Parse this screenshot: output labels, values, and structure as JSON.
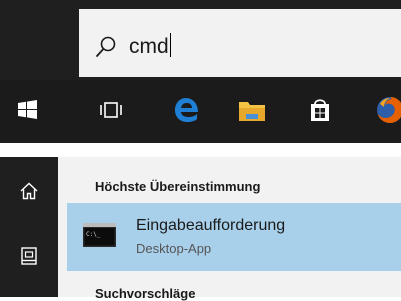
{
  "search": {
    "query": "cmd",
    "icon": "search-icon"
  },
  "taskbar": {
    "items": [
      {
        "name": "start-button",
        "icon": "windows-logo-icon"
      },
      {
        "name": "task-view-button",
        "icon": "task-view-icon"
      },
      {
        "name": "edge-browser",
        "icon": "edge-icon"
      },
      {
        "name": "file-explorer",
        "icon": "folder-icon"
      },
      {
        "name": "microsoft-store",
        "icon": "store-bag-icon"
      },
      {
        "name": "firefox-browser",
        "icon": "firefox-icon"
      }
    ]
  },
  "sidebar": {
    "items": [
      {
        "name": "home",
        "icon": "home-icon"
      },
      {
        "name": "documents",
        "icon": "document-icon"
      }
    ]
  },
  "results": {
    "best_match_heading": "Höchste Übereinstimmung",
    "best_match": {
      "title": "Eingabeaufforderung",
      "subtitle": "Desktop-App",
      "icon_prompt": "C:\\_",
      "icon": "command-prompt-icon"
    },
    "suggestions_heading": "Suchvorschläge"
  },
  "colors": {
    "taskbar": "#1b1b1b",
    "search_background": "#f2f2f2",
    "selected_result": "#a9d0ea",
    "edge_blue": "#1e7fd4",
    "folder_yellow": "#f5c343",
    "firefox_orange": "#e66000"
  }
}
